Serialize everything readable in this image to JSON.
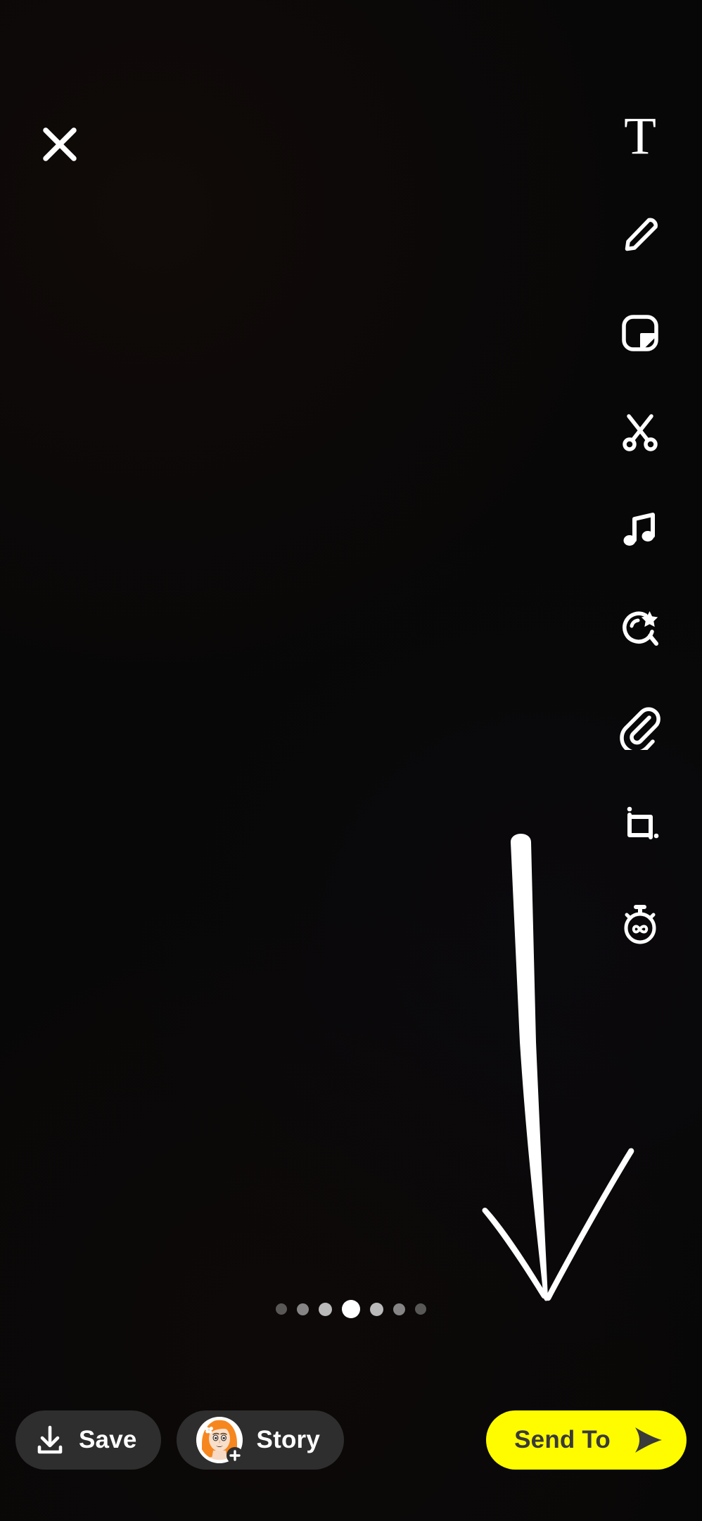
{
  "app": {
    "screen_name": "Snap Preview / Send",
    "background_color": "#080707",
    "accent_color": "#FFFC00",
    "pill_color": "#2e2e2e",
    "stroke_color": "#ffffff"
  },
  "top_bar": {
    "close": {
      "label": "Close",
      "icon": "close-icon"
    }
  },
  "tool_rail": {
    "items": [
      {
        "id": "text",
        "icon": "text-icon",
        "label": "T",
        "glyph": "T"
      },
      {
        "id": "draw",
        "icon": "pencil-icon",
        "label": "Draw"
      },
      {
        "id": "sticker",
        "icon": "sticker-icon",
        "label": "Stickers"
      },
      {
        "id": "cutout",
        "icon": "scissors-icon",
        "label": "Scissors"
      },
      {
        "id": "music",
        "icon": "music-note-icon",
        "label": "Music"
      },
      {
        "id": "lens",
        "icon": "lens-star-icon",
        "label": "Lenses"
      },
      {
        "id": "attach",
        "icon": "paperclip-icon",
        "label": "Attach Link"
      },
      {
        "id": "crop",
        "icon": "crop-icon",
        "label": "Crop"
      },
      {
        "id": "timer",
        "icon": "timer-infinity-icon",
        "label": "Timer",
        "value": "∞"
      }
    ]
  },
  "drawing": {
    "name": "hand-drawn-arrow",
    "description": "white downward hand-drawn arrow",
    "color": "#ffffff"
  },
  "carousel": {
    "total_dots": 7,
    "active_index": 3,
    "dots": [
      {
        "size": 16,
        "opacity": 0.32
      },
      {
        "size": 17,
        "opacity": 0.5
      },
      {
        "size": 19,
        "opacity": 0.72
      },
      {
        "size": 26,
        "opacity": 1
      },
      {
        "size": 19,
        "opacity": 0.72
      },
      {
        "size": 17,
        "opacity": 0.5
      },
      {
        "size": 16,
        "opacity": 0.32
      }
    ]
  },
  "bottom_bar": {
    "save": {
      "label": "Save",
      "icon": "download-icon"
    },
    "story": {
      "label": "Story",
      "icon": "bitmoji-avatar",
      "badge": "+"
    },
    "send_to": {
      "label": "Send To",
      "icon": "send-arrow-icon"
    }
  }
}
